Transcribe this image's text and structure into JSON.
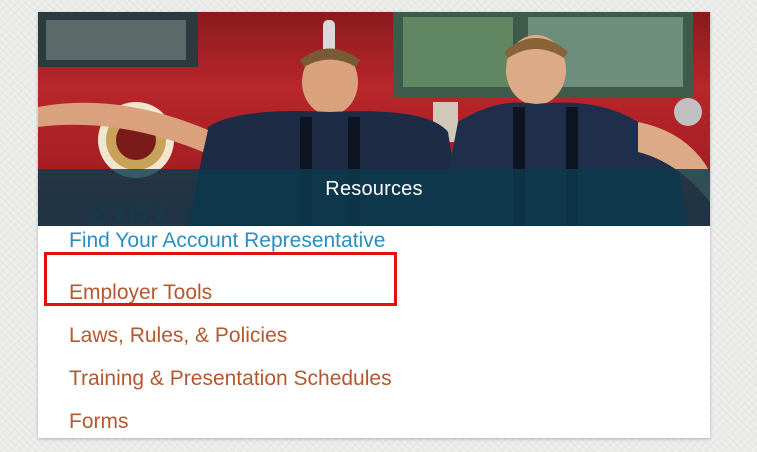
{
  "card": {
    "banner_title": "Resources",
    "links": {
      "primary": "Find Your Account Representative",
      "employer_tools": "Employer Tools",
      "laws": "Laws, Rules, & Policies",
      "training": "Training & Presentation Schedules",
      "forms": "Forms"
    }
  },
  "colors": {
    "primary_link": "#2a8fc0",
    "secondary_link": "#b4582e",
    "banner": "#0c3a4e",
    "highlight": "#e3100f"
  },
  "highlight_target": "employer-tools-link"
}
